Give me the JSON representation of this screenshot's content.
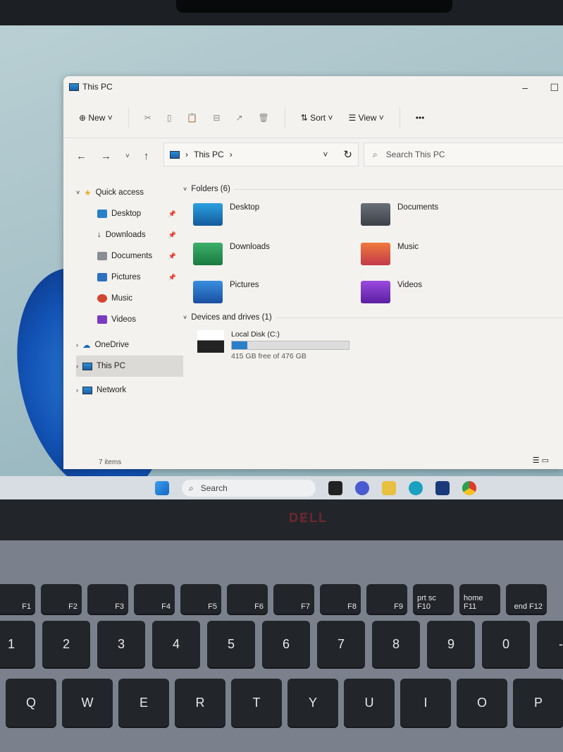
{
  "window": {
    "title": "This PC"
  },
  "toolbar": {
    "new": "New",
    "sort": "Sort",
    "view": "View",
    "more": "•••"
  },
  "address": {
    "path": "This PC",
    "search_placeholder": "Search This PC"
  },
  "nav": [
    {
      "label": "Quick access",
      "icon": "star-icon"
    },
    {
      "label": "Desktop",
      "pinned": true
    },
    {
      "label": "Downloads",
      "pinned": true
    },
    {
      "label": "Documents",
      "pinned": true
    },
    {
      "label": "Pictures",
      "pinned": true
    },
    {
      "label": "Music"
    },
    {
      "label": "Videos"
    },
    {
      "label": "OneDrive"
    },
    {
      "label": "This PC",
      "selected": true
    },
    {
      "label": "Network"
    }
  ],
  "folders_header": "Folders (6)",
  "folders": [
    {
      "label": "Desktop"
    },
    {
      "label": "Documents"
    },
    {
      "label": "Downloads"
    },
    {
      "label": "Music"
    },
    {
      "label": "Pictures"
    },
    {
      "label": "Videos"
    }
  ],
  "drives_header": "Devices and drives (1)",
  "drive": {
    "label": "Local Disk (C:)",
    "free": "415 GB free of 476 GB",
    "used_fraction": 0.13
  },
  "status": "7 items",
  "taskbar": {
    "search": "Search"
  },
  "bezel_logo": "DELL",
  "keys": {
    "fn": [
      "F1",
      "F2",
      "F3",
      "F4",
      "F5",
      "F6",
      "F7",
      "F8",
      "F9",
      "prt sc F10",
      "home F11",
      "end F12"
    ],
    "num": [
      "1",
      "2",
      "3",
      "4",
      "5",
      "6",
      "7",
      "8",
      "9",
      "0",
      "-"
    ],
    "top": [
      "Q",
      "W",
      "E",
      "R",
      "T",
      "Y",
      "U",
      "I",
      "O",
      "P"
    ]
  }
}
